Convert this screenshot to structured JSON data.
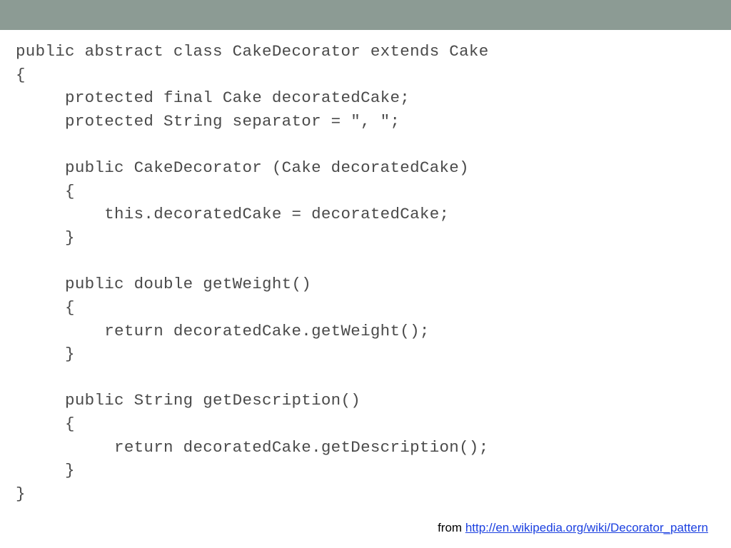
{
  "code": {
    "lines": [
      "public abstract class CakeDecorator extends Cake",
      "{",
      "     protected final Cake decoratedCake;",
      "     protected String separator = \", \";",
      "",
      "     public CakeDecorator (Cake decoratedCake)",
      "     {",
      "         this.decoratedCake = decoratedCake;",
      "     }",
      "",
      "     public double getWeight()",
      "     {",
      "         return decoratedCake.getWeight();",
      "     }",
      "",
      "     public String getDescription()",
      "     {",
      "          return decoratedCake.getDescription();",
      "     }",
      "}"
    ]
  },
  "footer": {
    "prefix": "from ",
    "link_text": "http://en.wikipedia.org/wiki/Decorator_pattern",
    "link_href": "http://en.wikipedia.org/wiki/Decorator_pattern"
  }
}
